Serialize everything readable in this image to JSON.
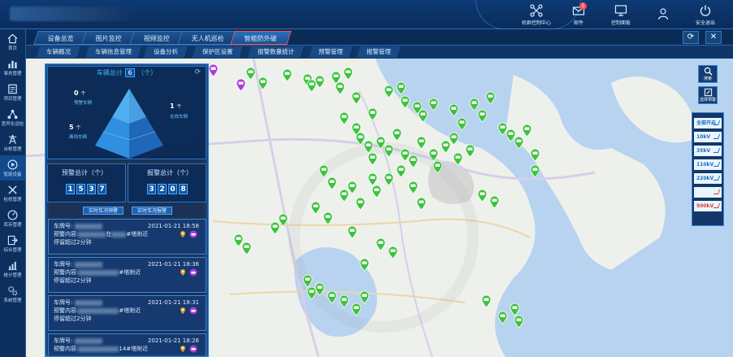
{
  "top_actions": [
    {
      "label": "机群控制中心",
      "icon": "drone-icon"
    },
    {
      "label": "邮件",
      "icon": "mail-icon",
      "badge": "5"
    },
    {
      "label": "控制面板",
      "icon": "panel-icon"
    },
    {
      "label": "",
      "icon": "user-icon"
    },
    {
      "label": "安全退出",
      "icon": "power-icon"
    }
  ],
  "nav": [
    {
      "label": "首页",
      "icon": "home-icon"
    },
    {
      "label": "事务管理",
      "icon": "chart-icon"
    },
    {
      "label": "项目管理",
      "icon": "document-icon"
    },
    {
      "label": "差异化运检",
      "icon": "network-icon"
    },
    {
      "label": "台帐管理",
      "icon": "tower-icon"
    },
    {
      "label": "智能设备",
      "icon": "play-icon"
    },
    {
      "label": "检修管理",
      "icon": "tools-icon"
    },
    {
      "label": "库存管理",
      "icon": "gauge-icon"
    },
    {
      "label": "综合管理",
      "icon": "exit-icon"
    },
    {
      "label": "统计管理",
      "icon": "stats-icon"
    },
    {
      "label": "系统管理",
      "icon": "gears-icon"
    }
  ],
  "tabs": [
    "设备总览",
    "图片监控",
    "视频监控",
    "无人机巡检",
    "智能防外破"
  ],
  "active_tab": "智能防外破",
  "subtabs": [
    "车辆概况",
    "车辆信息管理",
    "设备分析",
    "保护区设置",
    "报警数量统计",
    "预警管理",
    "报警管理"
  ],
  "vehicle_total": {
    "label": "车辆总计",
    "value": "6",
    "unit": "（个）"
  },
  "pyramid": {
    "warning": {
      "count": "0",
      "unit": "个",
      "label": "预警车辆"
    },
    "online": {
      "count": "1",
      "unit": "个",
      "label": "在线车辆"
    },
    "offline": {
      "count": "5",
      "unit": "个",
      "label": "离线车辆"
    }
  },
  "warning_total": {
    "label": "预警总计（个）",
    "digits": [
      "1",
      "5",
      "3",
      "7"
    ]
  },
  "alarm_total": {
    "label": "报警总计（个）",
    "digits": [
      "3",
      "2",
      "0",
      "8"
    ]
  },
  "buttons": {
    "realtime_warning": "实时车况预警",
    "realtime_alarm": "实时车况报警"
  },
  "alerts": [
    {
      "plate_label": "车牌号:",
      "time": "2021-01-21 18:58",
      "content_label": "预警内容:",
      "content_mid": "在",
      "content_tail": "#塔附近",
      "stay": "停留超过2分钟"
    },
    {
      "plate_label": "车牌号:",
      "time": "2021-01-21 18:36",
      "content_label": "预警内容:",
      "content_mid": "",
      "content_tail": "#塔附近",
      "stay": "停留超过2分钟"
    },
    {
      "plate_label": "车牌号:",
      "time": "2021-01-21 18:31",
      "content_label": "预警内容:",
      "content_mid": "",
      "content_tail": "#塔附近",
      "stay": "停留超过2分钟"
    },
    {
      "plate_label": "车牌号:",
      "time": "2021-01-21 18:26",
      "content_label": "预警内容:",
      "content_mid": "",
      "content_tail": "14#塔附近",
      "stay": ""
    }
  ],
  "right_buttons": {
    "search": "搜索",
    "device_warning": "选择预警"
  },
  "voltages": [
    {
      "label": "全部开启",
      "color": "blue"
    },
    {
      "label": "10kV",
      "color": "blue"
    },
    {
      "label": "35kV",
      "color": "blue"
    },
    {
      "label": "110kV",
      "color": "blue"
    },
    {
      "label": "220kV",
      "color": "blue"
    },
    {
      "label": "",
      "color": "red"
    },
    {
      "label": "500kV",
      "color": "red"
    }
  ],
  "colors": {
    "accent": "#2f8ae5",
    "pin_green": "#3cc43c",
    "pin_purple": "#b23ad6",
    "active_tab_border": "#ff4d4d"
  }
}
